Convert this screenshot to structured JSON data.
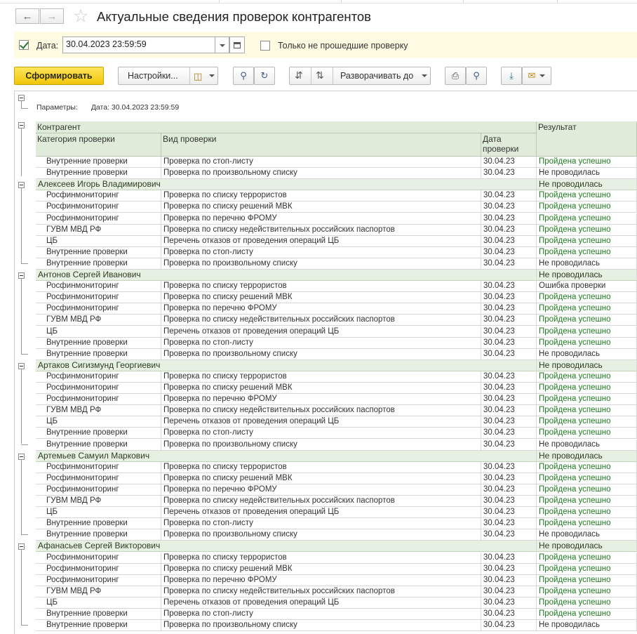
{
  "window": {
    "title": "Актуальные сведения проверок контрагентов"
  },
  "filter": {
    "date_label": "Дата:",
    "date_value": "30.04.2023 23:59:59",
    "only_failed_label": "Только не прошедшие проверку",
    "date_checked": true,
    "only_failed_checked": false
  },
  "toolbar": {
    "generate": "Сформировать",
    "settings": "Настройки...",
    "expand_to": "Разворачивать до"
  },
  "report": {
    "params_label": "Параметры:",
    "params_value": "Дата: 30.04.2023 23:59:59",
    "headers": {
      "counterparty": "Контрагент",
      "result": "Результат",
      "category": "Категория проверки",
      "check_type": "Вид проверки",
      "date": "Дата проверки"
    },
    "top_rows": [
      {
        "category": "Внутренние проверки",
        "type": "Проверка по стоп-листу",
        "date": "30.04.23",
        "result": "Пройдена успешно",
        "status": "ok"
      },
      {
        "category": "Внутренние проверки",
        "type": "Проверка по произвольному списку",
        "date": "30.04.23",
        "result": "Не проводилась",
        "status": "notdone"
      }
    ],
    "groups": [
      {
        "name": "Алексеев Игорь Владимирович",
        "result": "Не проводилась",
        "rows": [
          {
            "category": "Росфинмониторинг",
            "type": "Проверка по списку террористов",
            "date": "30.04.23",
            "result": "Пройдена успешно",
            "status": "ok"
          },
          {
            "category": "Росфинмониторинг",
            "type": "Проверка по списку решений МВК",
            "date": "30.04.23",
            "result": "Пройдена успешно",
            "status": "ok"
          },
          {
            "category": "Росфинмониторинг",
            "type": "Проверка по перечню ФРОМУ",
            "date": "30.04.23",
            "result": "Пройдена успешно",
            "status": "ok"
          },
          {
            "category": "ГУВМ МВД РФ",
            "type": "Проверка по списку недействительных российских паспортов",
            "date": "30.04.23",
            "result": "Пройдена успешно",
            "status": "ok"
          },
          {
            "category": "ЦБ",
            "type": "Перечень отказов от проведения операций ЦБ",
            "date": "30.04.23",
            "result": "Пройдена успешно",
            "status": "ok"
          },
          {
            "category": "Внутренние проверки",
            "type": "Проверка по стоп-листу",
            "date": "30.04.23",
            "result": "Пройдена успешно",
            "status": "ok"
          },
          {
            "category": "Внутренние проверки",
            "type": "Проверка по произвольному списку",
            "date": "30.04.23",
            "result": "Не проводилась",
            "status": "notdone"
          }
        ]
      },
      {
        "name": "Антонов Сергей Иванович",
        "result": "Не проводилась",
        "rows": [
          {
            "category": "Росфинмониторинг",
            "type": "Проверка по списку террористов",
            "date": "30.04.23",
            "result": "Ошибка проверки",
            "status": "err"
          },
          {
            "category": "Росфинмониторинг",
            "type": "Проверка по списку решений МВК",
            "date": "30.04.23",
            "result": "Пройдена успешно",
            "status": "ok"
          },
          {
            "category": "Росфинмониторинг",
            "type": "Проверка по перечню ФРОМУ",
            "date": "30.04.23",
            "result": "Пройдена успешно",
            "status": "ok"
          },
          {
            "category": "ГУВМ МВД РФ",
            "type": "Проверка по списку недействительных российских паспортов",
            "date": "30.04.23",
            "result": "Пройдена успешно",
            "status": "ok"
          },
          {
            "category": "ЦБ",
            "type": "Перечень отказов от проведения операций ЦБ",
            "date": "30.04.23",
            "result": "Пройдена успешно",
            "status": "ok"
          },
          {
            "category": "Внутренние проверки",
            "type": "Проверка по стоп-листу",
            "date": "30.04.23",
            "result": "Пройдена успешно",
            "status": "ok"
          },
          {
            "category": "Внутренние проверки",
            "type": "Проверка по произвольному списку",
            "date": "30.04.23",
            "result": "Не проводилась",
            "status": "notdone"
          }
        ]
      },
      {
        "name": "Артаков Сигизмунд Георгиевич",
        "result": "Не проводилась",
        "rows": [
          {
            "category": "Росфинмониторинг",
            "type": "Проверка по списку террористов",
            "date": "30.04.23",
            "result": "Пройдена успешно",
            "status": "ok"
          },
          {
            "category": "Росфинмониторинг",
            "type": "Проверка по списку решений МВК",
            "date": "30.04.23",
            "result": "Пройдена успешно",
            "status": "ok"
          },
          {
            "category": "Росфинмониторинг",
            "type": "Проверка по перечню ФРОМУ",
            "date": "30.04.23",
            "result": "Пройдена успешно",
            "status": "ok"
          },
          {
            "category": "ГУВМ МВД РФ",
            "type": "Проверка по списку недействительных российских паспортов",
            "date": "30.04.23",
            "result": "Пройдена успешно",
            "status": "ok"
          },
          {
            "category": "ЦБ",
            "type": "Перечень отказов от проведения операций ЦБ",
            "date": "30.04.23",
            "result": "Пройдена успешно",
            "status": "ok"
          },
          {
            "category": "Внутренние проверки",
            "type": "Проверка по стоп-листу",
            "date": "30.04.23",
            "result": "Пройдена успешно",
            "status": "ok"
          },
          {
            "category": "Внутренние проверки",
            "type": "Проверка по произвольному списку",
            "date": "30.04.23",
            "result": "Не проводилась",
            "status": "notdone"
          }
        ]
      },
      {
        "name": "Артемьев Самуил Маркович",
        "result": "Не проводилась",
        "rows": [
          {
            "category": "Росфинмониторинг",
            "type": "Проверка по списку террористов",
            "date": "30.04.23",
            "result": "Пройдена успешно",
            "status": "ok"
          },
          {
            "category": "Росфинмониторинг",
            "type": "Проверка по списку решений МВК",
            "date": "30.04.23",
            "result": "Пройдена успешно",
            "status": "ok"
          },
          {
            "category": "Росфинмониторинг",
            "type": "Проверка по перечню ФРОМУ",
            "date": "30.04.23",
            "result": "Пройдена успешно",
            "status": "ok"
          },
          {
            "category": "ГУВМ МВД РФ",
            "type": "Проверка по списку недействительных российских паспортов",
            "date": "30.04.23",
            "result": "Пройдена успешно",
            "status": "ok"
          },
          {
            "category": "ЦБ",
            "type": "Перечень отказов от проведения операций ЦБ",
            "date": "30.04.23",
            "result": "Пройдена успешно",
            "status": "ok"
          },
          {
            "category": "Внутренние проверки",
            "type": "Проверка по стоп-листу",
            "date": "30.04.23",
            "result": "Пройдена успешно",
            "status": "ok"
          },
          {
            "category": "Внутренние проверки",
            "type": "Проверка по произвольному списку",
            "date": "30.04.23",
            "result": "Не проводилась",
            "status": "notdone"
          }
        ]
      },
      {
        "name": "Афанасьев Сергей Викторович",
        "result": "Не проводилась",
        "rows": [
          {
            "category": "Росфинмониторинг",
            "type": "Проверка по списку террористов",
            "date": "30.04.23",
            "result": "Пройдена успешно",
            "status": "ok"
          },
          {
            "category": "Росфинмониторинг",
            "type": "Проверка по списку решений МВК",
            "date": "30.04.23",
            "result": "Пройдена успешно",
            "status": "ok"
          },
          {
            "category": "Росфинмониторинг",
            "type": "Проверка по перечню ФРОМУ",
            "date": "30.04.23",
            "result": "Пройдена успешно",
            "status": "ok"
          },
          {
            "category": "ГУВМ МВД РФ",
            "type": "Проверка по списку недействительных российских паспортов",
            "date": "30.04.23",
            "result": "Пройдена успешно",
            "status": "ok"
          },
          {
            "category": "ЦБ",
            "type": "Перечень отказов от проведения операций ЦБ",
            "date": "30.04.23",
            "result": "Пройдена успешно",
            "status": "ok"
          },
          {
            "category": "Внутренние проверки",
            "type": "Проверка по стоп-листу",
            "date": "30.04.23",
            "result": "Пройдена успешно",
            "status": "ok"
          },
          {
            "category": "Внутренние проверки",
            "type": "Проверка по произвольному списку",
            "date": "30.04.23",
            "result": "Не проводилась",
            "status": "notdone"
          }
        ]
      }
    ]
  }
}
